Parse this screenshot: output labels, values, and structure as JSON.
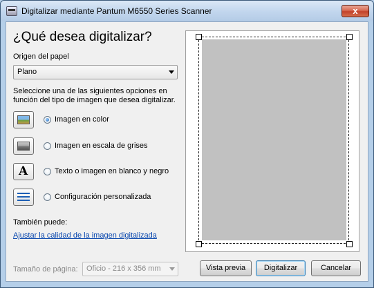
{
  "window": {
    "title": "Digitalizar mediante Pantum M6550 Series Scanner",
    "close_symbol": "x"
  },
  "main": {
    "heading": "¿Qué desea digitalizar?",
    "origin_label": "Origen del papel",
    "origin_value": "Plano",
    "description": "Seleccione una de las siguientes opciones en función del tipo de imagen que desea digitalizar.",
    "options": [
      {
        "label": "Imagen en color",
        "icon": "color-photo-icon",
        "checked": true
      },
      {
        "label": "Imagen en escala de grises",
        "icon": "grayscale-photo-icon",
        "checked": false
      },
      {
        "label": "Texto o imagen en blanco y negro",
        "icon": "text-bw-icon",
        "checked": false
      },
      {
        "label": "Configuración personalizada",
        "icon": "custom-settings-icon",
        "checked": false
      }
    ],
    "also_label": "También puede:",
    "adjust_link": "Ajustar la calidad de la imagen digitalizada",
    "page_size_label": "Tamaño de página:",
    "page_size_value": "Oficio - 216 x 356 mm"
  },
  "buttons": {
    "preview": "Vista previa",
    "scan": "Digitalizar",
    "cancel": "Cancelar"
  },
  "colors": {
    "link": "#0645ad",
    "preview_page": "#c1c1c1",
    "close_button": "#c2422a"
  }
}
